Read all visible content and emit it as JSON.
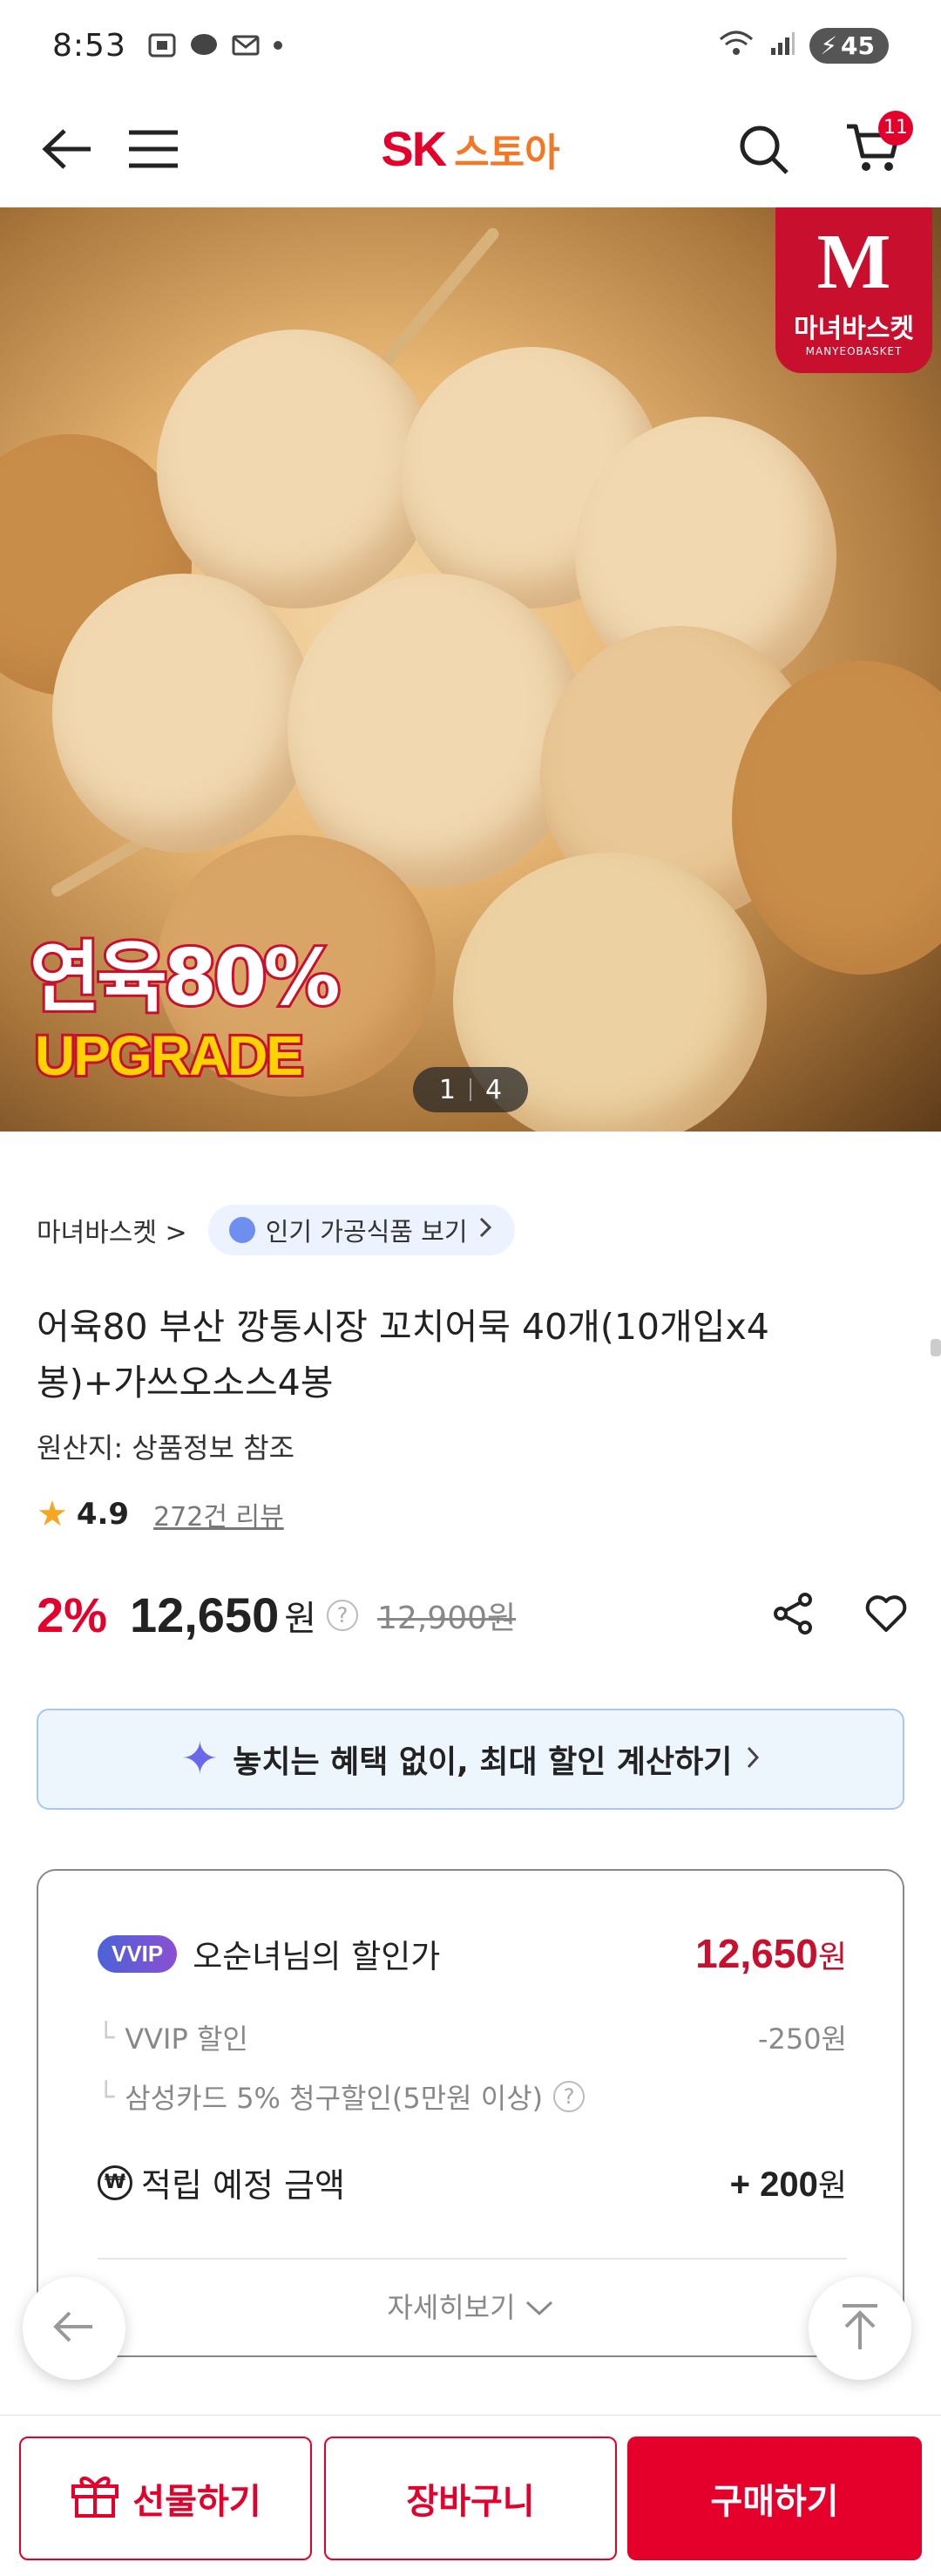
{
  "status": {
    "time": "8:53",
    "battery": "45"
  },
  "header": {
    "logo_sk": "SK",
    "logo_store": "스토아",
    "cart_count": "11"
  },
  "gallery": {
    "brand_badge_text": "마녀바스켓",
    "brand_badge_en": "MANYEOBASKET",
    "promo_line1": "연육80%",
    "promo_line2": "UPGRADE",
    "current": "1",
    "total": "4"
  },
  "product": {
    "brand": "마녀바스켓",
    "brand_chevron": ">",
    "category_pill": "인기 가공식품 보기",
    "title": "어육80 부산 깡통시장 꼬치어묵 40개(10개입x4봉)+가쓰오소스4봉",
    "origin": "원산지: 상품정보 참조",
    "rating": "4.9",
    "review_count": "272건 리뷰",
    "discount": "2%",
    "price": "12,650",
    "price_unit": "원",
    "original_price": "12,900원"
  },
  "benefit_banner": {
    "label": "놓치는 혜택 없이, 최대 할인 계산하기"
  },
  "discount_card": {
    "vip_badge": "VVIP",
    "member_label": "오순녀님의 할인가",
    "member_price": "12,650",
    "member_price_unit": "원",
    "lines": [
      {
        "label": "VVIP 할인",
        "amount": "-250원"
      },
      {
        "label": "삼성카드 5% 청구할인(5만원 이상)",
        "amount": ""
      }
    ],
    "points_label": "적립 예정 금액",
    "points_value": "+ 200",
    "points_unit": "원",
    "more_label": "자세히보기"
  },
  "bottom_bar": {
    "gift": "선물하기",
    "cart": "장바구니",
    "buy": "구매하기"
  },
  "colors": {
    "accent": "#e4002b",
    "logo_store": "#f47725",
    "vip_price": "#c8102e"
  }
}
